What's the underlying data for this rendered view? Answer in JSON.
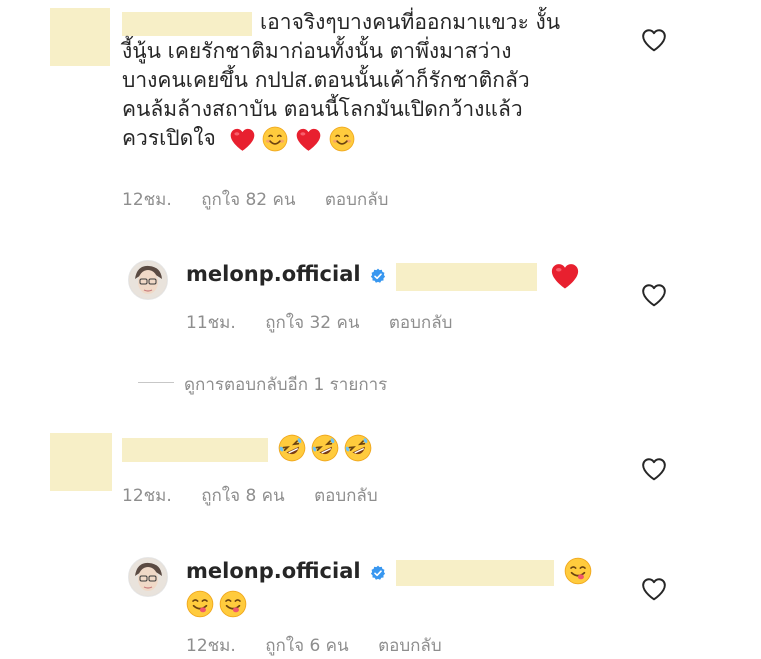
{
  "comments": [
    {
      "lines": [
        "เอาจริงๆบางคนที่ออกมาแขวะ งั้น",
        "งี้นู้น เคยรักชาติมาก่อนทั้งนั้น ตาพึ่งมาสว่าง",
        "บางคนเคยขึ้น กปปส.ตอนนั้นเค้าก็รักชาติกลัว",
        "คนล้มล้างสถาบัน ตอนนี้โลกมันเปิดกว้างแล้ว",
        "ควรเปิดใจ"
      ],
      "time": "12ชม.",
      "likes": "ถูกใจ 82 คน",
      "reply": "ตอบกลับ"
    },
    {
      "username": "melonp.official",
      "time": "11ชม.",
      "likes": "ถูกใจ 32 คน",
      "reply": "ตอบกลับ"
    },
    {
      "time": "12ชม.",
      "likes": "ถูกใจ 8 คน",
      "reply": "ตอบกลับ"
    },
    {
      "username": "melonp.official",
      "time": "12ชม.",
      "likes": "ถูกใจ 6 คน",
      "reply": "ตอบกลับ"
    }
  ],
  "view_replies": "ดูการตอบกลับอีก 1 รายการ",
  "icons": {
    "like": "heart-outline-icon",
    "verified": "verified-badge-icon",
    "red_heart": "red-heart-emoji",
    "smile": "smiling-emoji",
    "rofl": "rolling-laughing-emoji",
    "yum": "yum-emoji"
  },
  "colors": {
    "verified": "#3897f0",
    "meta": "#8e8e8e",
    "redaction": "#f7efc7"
  }
}
